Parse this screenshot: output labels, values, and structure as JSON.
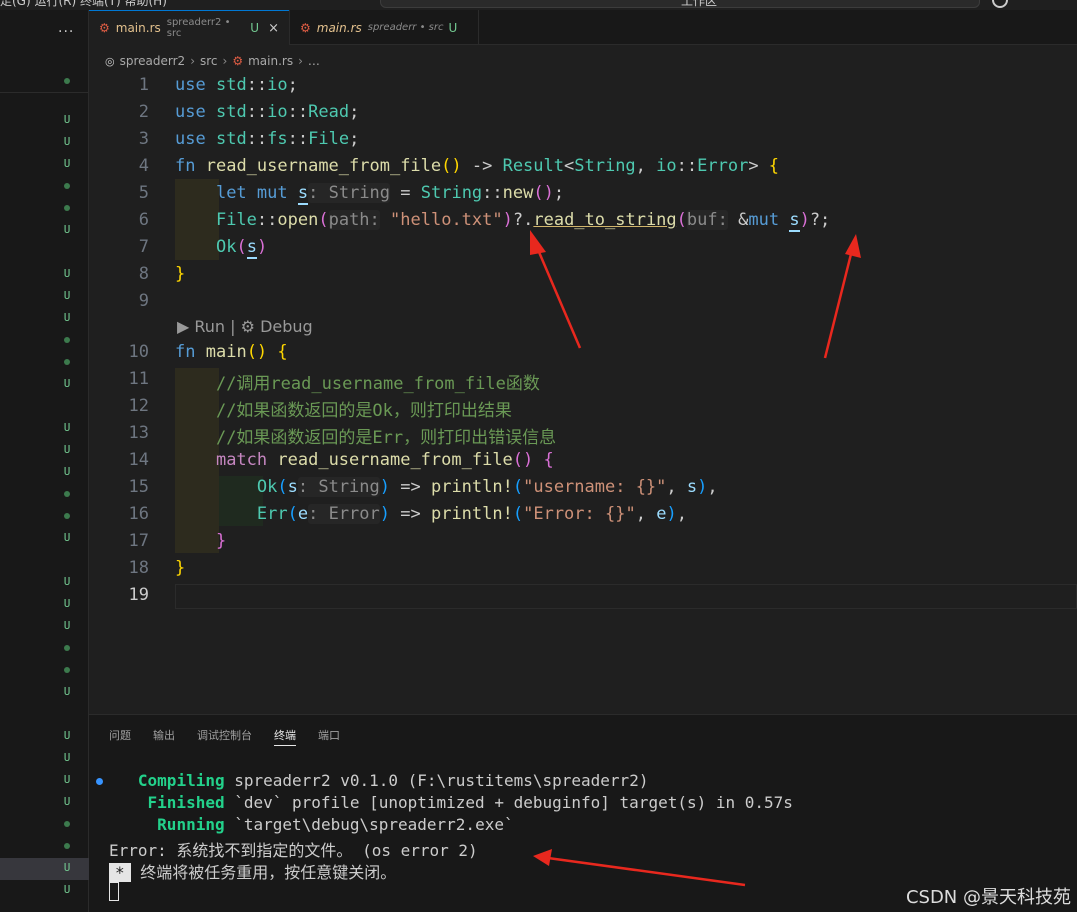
{
  "topbar": {
    "menu_text": "走(G)   运行(R)   终端(T)   帮助(H)",
    "title_text": "工作区"
  },
  "sidebar": {
    "more_label": "···",
    "statuses": [
      "●",
      "U",
      "U",
      "U",
      "●",
      "●",
      "U",
      "U",
      "U",
      "U",
      "●",
      "●",
      "U",
      "U",
      "U",
      "U",
      "●",
      "●",
      "U",
      "U",
      "U",
      "U",
      "●",
      "●",
      "U",
      "U",
      "U",
      "U",
      "U",
      "●",
      "●",
      "U",
      "U"
    ]
  },
  "tabs": [
    {
      "icon": "rust-icon",
      "name": "main.rs",
      "desc": "spreaderr2 • src",
      "status": "U",
      "close": "×"
    },
    {
      "icon": "rust-icon",
      "name": "main.rs",
      "desc": "spreaderr • src",
      "status": "U"
    }
  ],
  "breadcrumb": {
    "root": "spreaderr2",
    "sep": "›",
    "folder": "src",
    "file": "main.rs",
    "tail": "…"
  },
  "editor": {
    "line_numbers": [
      "1",
      "2",
      "3",
      "4",
      "5",
      "6",
      "7",
      "8",
      "9",
      "10",
      "11",
      "12",
      "13",
      "14",
      "15",
      "16",
      "17",
      "18",
      "19"
    ],
    "codelens": "▶ Run | ⚙ Debug",
    "comments": {
      "c11": "//调用read_username_from_file函数",
      "c12": "//如果函数返回的是Ok，则打印出结果",
      "c13": "//如果函数返回的是Err，则打印出错误信息"
    }
  },
  "panel": {
    "tabs": [
      "问题",
      "输出",
      "调试控制台",
      "终端",
      "端口"
    ],
    "active_tab": "终端",
    "terminal": {
      "compiling_word": "Compiling",
      "compiling_rest": " spreaderr2 v0.1.0 (F:\\rustitems\\spreaderr2)",
      "finished_word": "Finished",
      "finished_rest": " `dev` profile [unoptimized + debuginfo] target(s) in 0.57s",
      "running_word": "Running",
      "running_rest": " `target\\debug\\spreaderr2.exe`",
      "error_line": "Error: 系统找不到指定的文件。 (os error 2)",
      "star": "*",
      "reuse_line": " 终端将被任务重用，按任意键关闭。"
    },
    "watermark": "CSDN @景天科技苑"
  },
  "colors": {
    "accent": "#0078d4",
    "annotation_arrow": "#e8281e",
    "git_untracked": "#73c991"
  }
}
